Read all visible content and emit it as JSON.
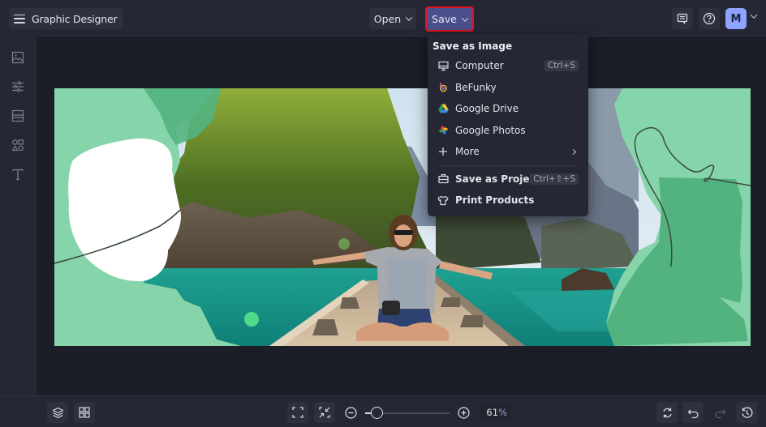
{
  "app": {
    "title": "Graphic Designer",
    "menu_icon": "hamburger-icon"
  },
  "topbar": {
    "open_label": "Open",
    "save_label": "Save",
    "feedback_icon": "comment-icon",
    "help_icon": "help-circle-icon",
    "avatar_initial": "M",
    "avatar_color": "#8ea3ff",
    "save_highlight_color": "#e5141c",
    "save_bg_color": "#4b4f8c"
  },
  "sidebar": {
    "items": [
      {
        "name": "image",
        "icon": "image-icon"
      },
      {
        "name": "adjust",
        "icon": "sliders-icon"
      },
      {
        "name": "layouts",
        "icon": "layout-icon"
      },
      {
        "name": "graphics",
        "icon": "shapes-icon"
      },
      {
        "name": "text",
        "icon": "text-icon"
      }
    ]
  },
  "save_menu": {
    "header": "Save as Image",
    "items": [
      {
        "label": "Computer",
        "icon": "monitor-icon",
        "shortcut": "Ctrl+S"
      },
      {
        "label": "BeFunky",
        "icon": "befunky-logo-icon"
      },
      {
        "label": "Google Drive",
        "icon": "google-drive-icon"
      },
      {
        "label": "Google Photos",
        "icon": "google-photos-icon"
      },
      {
        "label": "More",
        "icon": "plus-icon",
        "submenu": true
      }
    ],
    "project_items": [
      {
        "label": "Save as Project",
        "icon": "briefcase-icon",
        "shortcut": "Ctrl+⇧+S"
      },
      {
        "label": "Print Products",
        "icon": "tshirt-icon"
      }
    ]
  },
  "canvas": {
    "description": "Woman sitting cross-legged on the bow of a longtail boat with arms outstretched, turquoise lake and forested limestone cliffs, framed by mint-green brush strokes and a white paint blob with a looping line doodle",
    "bg_color": "#86d4aa",
    "accent_green": "#53b37f"
  },
  "bottombar": {
    "layers_icon": "layers-icon",
    "grid_icon": "grid-icon",
    "fit_icon": "fit-screen-icon",
    "actual_size_icon": "shrink-icon",
    "zoom_out_icon": "zoom-out-icon",
    "zoom_in_icon": "zoom-in-icon",
    "zoom_percent": 61,
    "zoom_value": "61",
    "zoom_unit": "%",
    "zoom_slider_fraction": 0.13,
    "refresh_icon": "refresh-icon",
    "undo_icon": "undo-icon",
    "redo_icon": "redo-icon",
    "history_icon": "history-icon"
  }
}
